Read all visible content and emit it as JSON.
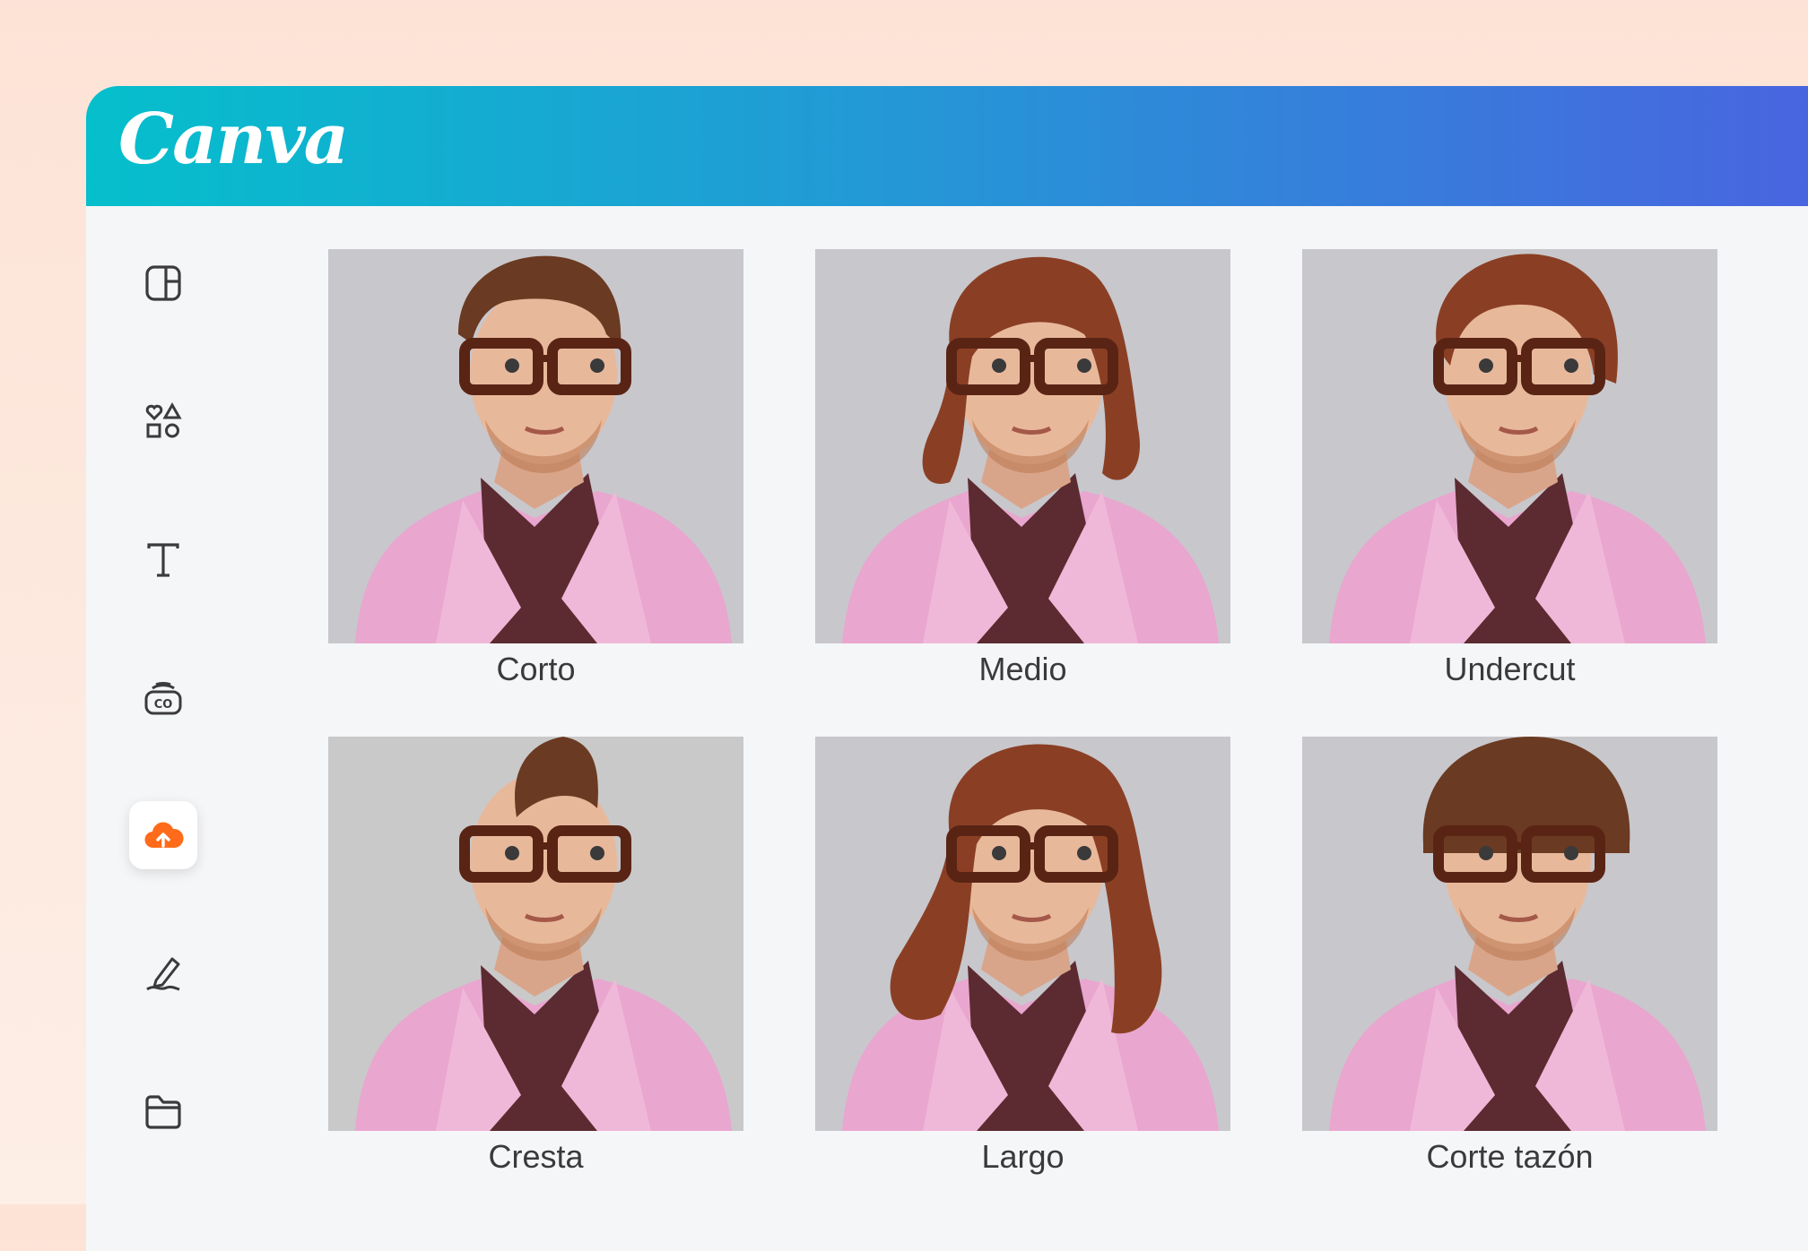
{
  "app": {
    "logo_text": "Canva"
  },
  "rail": {
    "items": [
      {
        "name": "rail-layout",
        "icon": "layout-icon",
        "active": false
      },
      {
        "name": "rail-elements",
        "icon": "elements-shapes-icon",
        "active": false
      },
      {
        "name": "rail-text",
        "icon": "text-icon",
        "active": false
      },
      {
        "name": "rail-brand",
        "icon": "brand-co-icon",
        "active": false
      },
      {
        "name": "rail-uploads",
        "icon": "cloud-upload-icon",
        "active": true
      },
      {
        "name": "rail-draw",
        "icon": "pen-draw-icon",
        "active": false
      },
      {
        "name": "rail-projects",
        "icon": "folder-icon",
        "active": false
      }
    ]
  },
  "colors": {
    "accent": "#ff6b1a",
    "jacket": "#e9a6cf",
    "shirt": "#5b2b31",
    "hair_dark": "#6b3a22",
    "hair_red": "#8a3f24"
  },
  "gallery": {
    "tiles": [
      {
        "label": "Corto",
        "hair": "short"
      },
      {
        "label": "Medio",
        "hair": "medium"
      },
      {
        "label": "Undercut",
        "hair": "undercut"
      },
      {
        "label": "Cresta",
        "hair": "mohawk"
      },
      {
        "label": "Largo",
        "hair": "long"
      },
      {
        "label": "Corte tazón",
        "hair": "bowl"
      }
    ]
  }
}
